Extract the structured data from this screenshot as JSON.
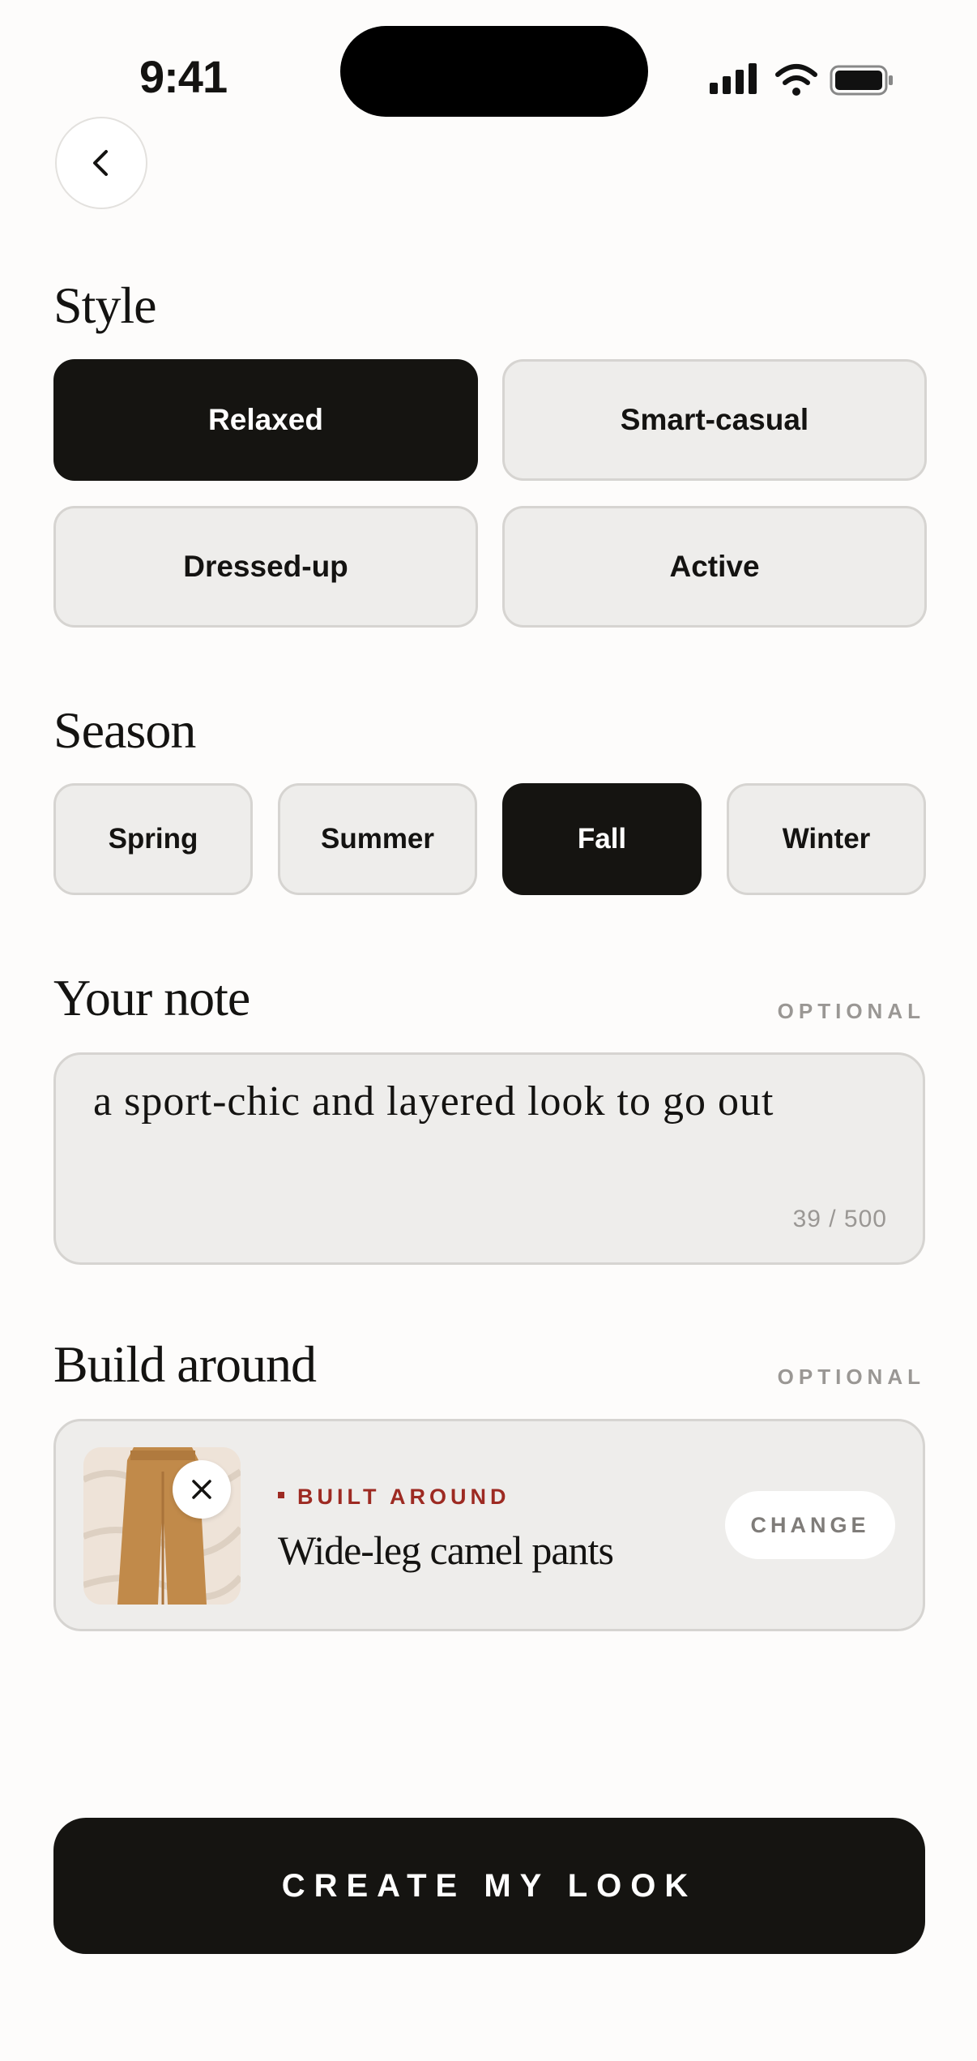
{
  "status_bar": {
    "time": "9:41"
  },
  "style": {
    "title": "Style",
    "options": [
      {
        "label": "Relaxed",
        "selected": true
      },
      {
        "label": "Smart-casual",
        "selected": false
      },
      {
        "label": "Dressed-up",
        "selected": false
      },
      {
        "label": "Active",
        "selected": false
      }
    ]
  },
  "season": {
    "title": "Season",
    "options": [
      {
        "label": "Spring",
        "selected": false
      },
      {
        "label": "Summer",
        "selected": false
      },
      {
        "label": "Fall",
        "selected": true
      },
      {
        "label": "Winter",
        "selected": false
      }
    ]
  },
  "note": {
    "title": "Your note",
    "optional_label": "OPTIONAL",
    "value": "a sport-chic and layered look to go out",
    "counter": "39 / 500"
  },
  "build_around": {
    "title": "Build around",
    "optional_label": "OPTIONAL",
    "tag": "BUILT AROUND",
    "item_name": "Wide-leg camel pants",
    "change_label": "CHANGE"
  },
  "cta": {
    "label": "CREATE MY LOOK"
  },
  "colors": {
    "selected": "#151411",
    "chip_bg": "#eeedeb",
    "accent": "#9d2a22"
  }
}
